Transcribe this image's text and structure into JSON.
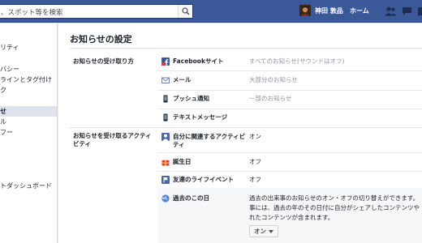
{
  "header": {
    "search_placeholder": "、スポット等を検索",
    "user_name": "神田 敦品",
    "home_label": "ホーム",
    "brand_color": "#3b5998"
  },
  "sidebar": {
    "items": [
      {
        "label": "リティ"
      },
      {
        "label": "バシー"
      },
      {
        "label": "ラインとタグ付け"
      },
      {
        "label": "ク"
      },
      {
        "label": "せ"
      },
      {
        "label": "ル"
      },
      {
        "label": "フー"
      },
      {
        "label": "トダッシュボード"
      }
    ],
    "active_index": 4
  },
  "main": {
    "title": "お知らせの設定",
    "sections": [
      {
        "label": "お知らせの受け取り方",
        "rows": [
          {
            "icon": "facebook-icon",
            "name": "Facebookサイト",
            "value": "すべてのお知らせ(サウンドはオフ)"
          },
          {
            "icon": "mail-icon",
            "name": "メール",
            "value": "大部分のお知らせ"
          },
          {
            "icon": "mobile-icon",
            "name": "プッシュ通知",
            "value": "一部のお知らせ"
          },
          {
            "icon": "text-message-icon",
            "name": "テキストメッセージ",
            "value": ""
          }
        ]
      },
      {
        "label": "お知らせを受け取るアクティビティ",
        "rows": [
          {
            "icon": "person-icon",
            "name": "自分に関連するアクティビティ",
            "value": "オン"
          },
          {
            "icon": "birthday-icon",
            "name": "誕生日",
            "value": "オフ"
          },
          {
            "icon": "flag-icon",
            "name": "友達のライフイベント",
            "value": "オフ"
          },
          {
            "icon": "on-this-day-icon",
            "name": "過去のこの日",
            "value": ""
          }
        ]
      }
    ],
    "on_this_day_description": [
      "過去の出来事のお知らせのオン・オフの切り替えができます。",
      "事には、過去の年のその日付に自分がシェアしたコンテンツや",
      "れたコンテンツが含まれます。"
    ],
    "on_this_day_select": "オン"
  }
}
